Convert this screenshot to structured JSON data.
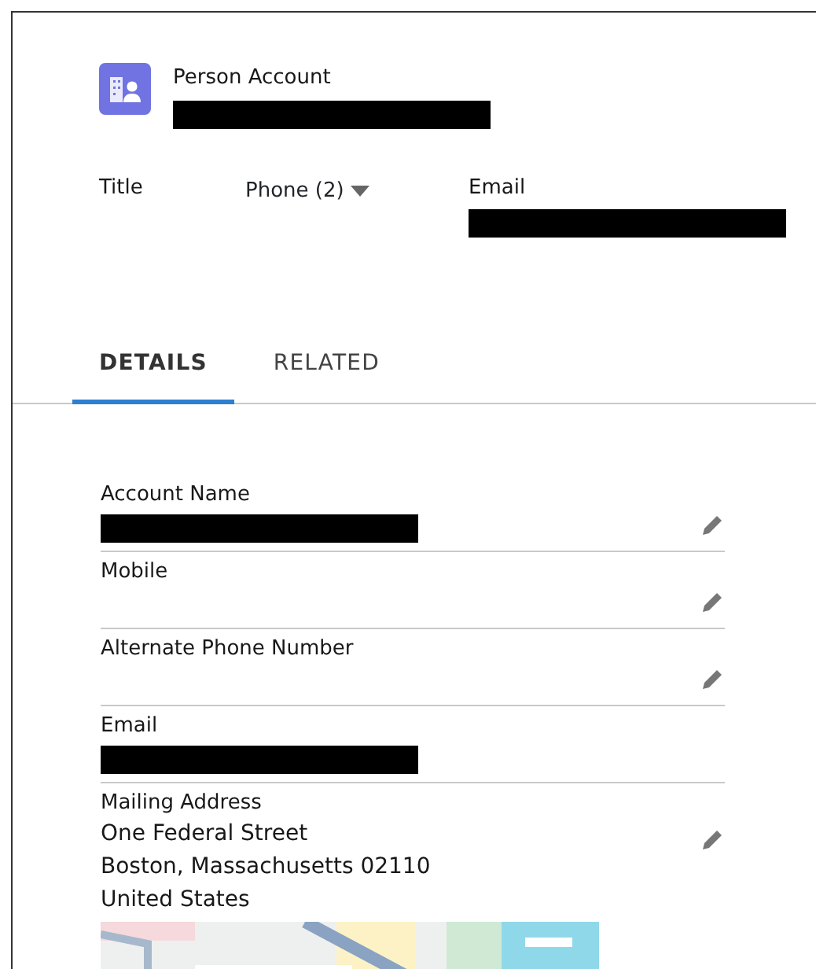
{
  "header": {
    "object_type": "Person Account",
    "name_redacted": true
  },
  "highlights": [
    {
      "kind": "label",
      "label": "Title"
    },
    {
      "kind": "dropdown",
      "label": "Phone (2)"
    },
    {
      "kind": "value",
      "label": "Email",
      "redacted": true
    }
  ],
  "tabs": [
    {
      "label": "DETAILS",
      "selected": true
    },
    {
      "label": "RELATED",
      "selected": false
    }
  ],
  "fields": [
    {
      "label": "Account Name",
      "redacted": true,
      "editable": true
    },
    {
      "label": "Mobile",
      "redacted": false,
      "editable": true
    },
    {
      "label": "Alternate Phone Number",
      "redacted": false,
      "editable": true
    },
    {
      "label": "Email",
      "redacted": true,
      "editable": false
    },
    {
      "label": "Mailing Address",
      "lines": [
        "One Federal Street",
        "Boston, Massachusetts 02110",
        "United States"
      ],
      "editable": true
    }
  ]
}
